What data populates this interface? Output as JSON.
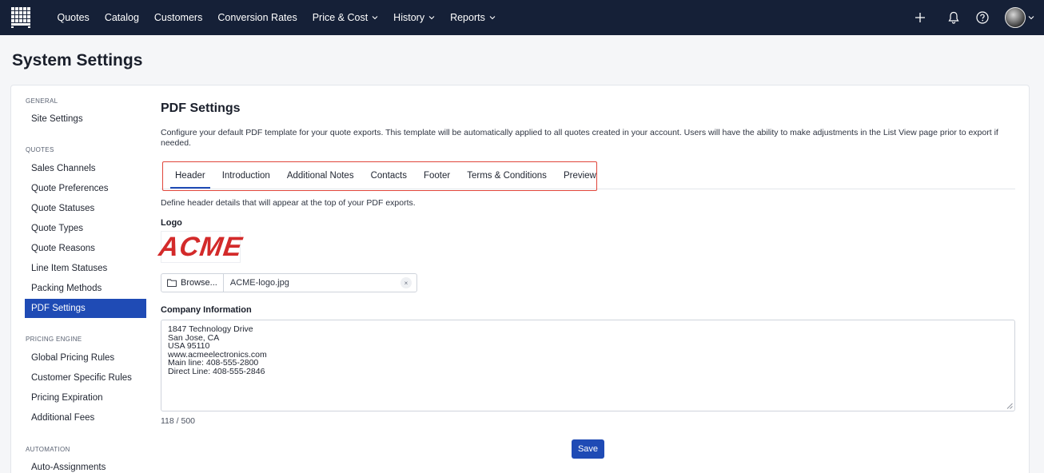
{
  "nav": {
    "items": [
      {
        "label": "Quotes",
        "has_menu": false
      },
      {
        "label": "Catalog",
        "has_menu": false
      },
      {
        "label": "Customers",
        "has_menu": false
      },
      {
        "label": "Conversion Rates",
        "has_menu": false
      },
      {
        "label": "Price & Cost",
        "has_menu": true
      },
      {
        "label": "History",
        "has_menu": true
      },
      {
        "label": "Reports",
        "has_menu": true
      }
    ],
    "right_icons": [
      "plus-icon",
      "bell-icon",
      "help-icon",
      "avatar"
    ]
  },
  "page": {
    "title": "System Settings"
  },
  "sidebar": {
    "groups": [
      {
        "label": "GENERAL",
        "items": [
          "Site Settings"
        ]
      },
      {
        "label": "QUOTES",
        "items": [
          "Sales Channels",
          "Quote Preferences",
          "Quote Statuses",
          "Quote Types",
          "Quote Reasons",
          "Line Item Statuses",
          "Packing Methods",
          "PDF Settings"
        ]
      },
      {
        "label": "PRICING ENGINE",
        "items": [
          "Global Pricing Rules",
          "Customer Specific Rules",
          "Pricing Expiration",
          "Additional Fees"
        ]
      },
      {
        "label": "AUTOMATION",
        "items": [
          "Auto-Assignments"
        ]
      }
    ],
    "active": "PDF Settings"
  },
  "content": {
    "title": "PDF Settings",
    "description": "Configure your default PDF template for your quote exports. This template will be automatically applied to all quotes created in your account. Users will have the ability to make adjustments in the List View page prior to export if needed.",
    "tabs": [
      "Header",
      "Introduction",
      "Additional Notes",
      "Contacts",
      "Footer",
      "Terms & Conditions",
      "Preview"
    ],
    "active_tab": "Header",
    "header_description": "Define header details that will appear at the top of your PDF exports.",
    "logo_label": "Logo",
    "logo_text": "ACME",
    "browse_label": "Browse...",
    "file_name": "ACME-logo.jpg",
    "company_label": "Company Information",
    "company_info": "1847 Technology Drive\nSan Jose, CA\nUSA 95110\nwww.acmeelectronics.com\nMain line: 408-555-2800\nDirect Line: 408-555-2846",
    "char_count": "118 / 500",
    "save_label": "Save"
  },
  "colors": {
    "nav_bg": "#152037",
    "accent": "#1f4bb5",
    "highlight_box": "#e0453a",
    "logo_red": "#d32a2a"
  }
}
